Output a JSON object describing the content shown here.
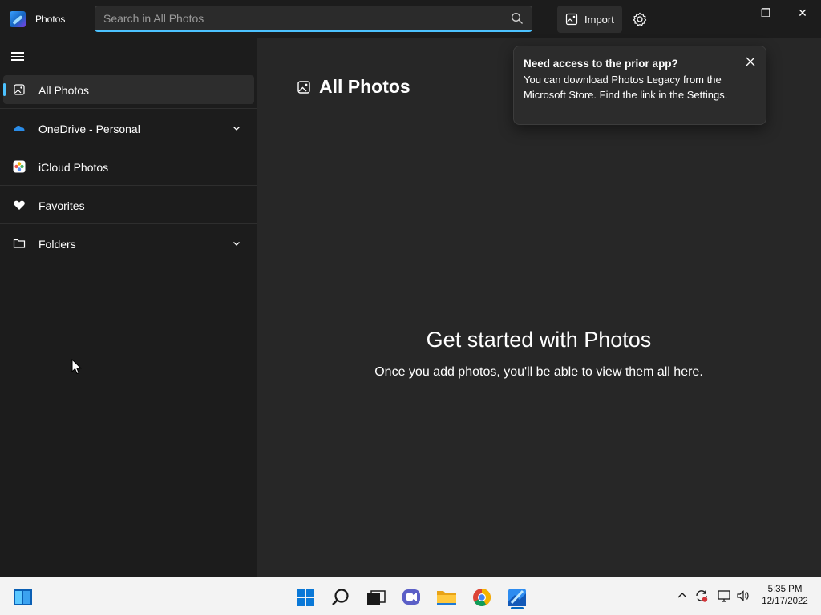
{
  "app": {
    "title": "Photos"
  },
  "search": {
    "placeholder": "Search in All Photos",
    "value": ""
  },
  "toolbar": {
    "import_label": "Import"
  },
  "window_controls": {
    "minimize": "—",
    "restore": "❐",
    "close": "✕"
  },
  "sidebar": {
    "items": [
      {
        "label": "All Photos",
        "icon": "gallery-icon",
        "active": true
      },
      {
        "label": "OneDrive - Personal",
        "icon": "onedrive-cloud-icon",
        "expandable": true
      },
      {
        "label": "iCloud Photos",
        "icon": "icloud-photos-icon"
      },
      {
        "label": "Favorites",
        "icon": "heart-icon"
      },
      {
        "label": "Folders",
        "icon": "folder-icon",
        "expandable": true
      }
    ]
  },
  "main": {
    "page_title": "All Photos",
    "empty_title": "Get started with Photos",
    "empty_subtitle": "Once you add photos, you'll be able to view them all here."
  },
  "teaching_tip": {
    "title": "Need access to the prior app?",
    "body": "You can download Photos Legacy from the Microsoft Store. Find the link in the Settings."
  },
  "taskbar": {
    "apps": [
      "widgets-icon",
      "start-icon",
      "search-icon",
      "task-view-icon",
      "chat-icon",
      "file-explorer-icon",
      "chrome-icon",
      "photos-icon"
    ],
    "tray": [
      "chevron-up-icon",
      "sync-icon",
      "network-icon",
      "volume-icon"
    ],
    "time": "5:35 PM",
    "date": "12/17/2022"
  },
  "colors": {
    "accent": "#4cc2ff",
    "background": "#272727",
    "sidebar": "#1c1c1c"
  }
}
